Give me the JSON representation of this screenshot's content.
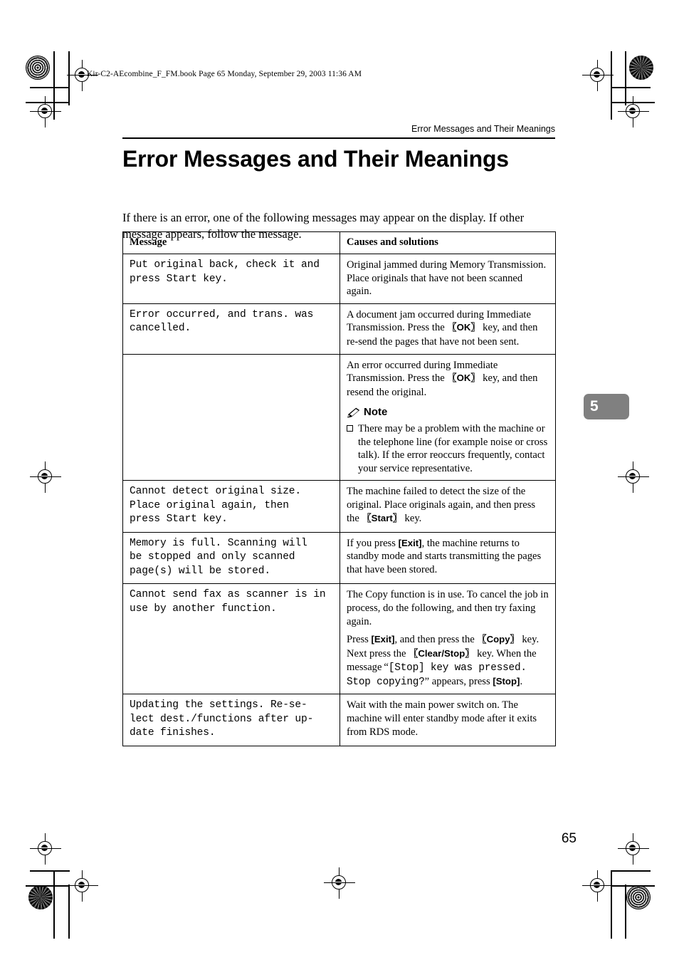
{
  "print_marks": {
    "book_line": "Kir-C2-AEcombine_F_FM.book  Page 65  Monday, September 29, 2003  11:36 AM"
  },
  "header": {
    "running_head": "Error Messages and Their Meanings",
    "title": "Error Messages and Their Meanings"
  },
  "intro": "If there is an error, one of the following messages may appear on the display. If other message appears, follow the message.",
  "table": {
    "columns": [
      "Message",
      "Causes and solutions"
    ],
    "rows": [
      {
        "message": "Put original back, check it and\npress Start key.",
        "solution_paragraphs": [
          "Original jammed during Memory Transmission. Place originals that have not been scanned again."
        ]
      },
      {
        "message": "Error occurred, and trans. was\ncancelled.",
        "solution_paragraphs": [
          "A document jam occurred during Immediate Transmission. Press the 【OK】 key, and then re-send the pages that have not been sent."
        ],
        "second_cell": {
          "paragraph": "An error occurred during Immediate Transmission. Press the 【OK】 key, and then resend the original.",
          "note_label": "Note",
          "note_items": [
            "There may be a problem with the machine or the telephone line (for example noise or cross talk). If the error reoccurs frequently, contact your service representative."
          ]
        }
      },
      {
        "message": "Cannot detect original size.\nPlace original again, then\npress Start key.",
        "solution_paragraphs": [
          "The machine failed to detect the size of the original. Place originals again, and then press the 【Start】 key."
        ]
      },
      {
        "message": "Memory is full. Scanning will\nbe stopped and only scanned\npage(s) will be stored.",
        "solution_paragraphs": [
          "If you press [Exit], the machine returns to standby mode and starts transmitting the pages that have been stored."
        ]
      },
      {
        "message": "Cannot send fax as scanner is in\nuse by another function.",
        "solution_paragraphs": [
          "The Copy function is in use. To cancel the job in process, do the following, and then try faxing again.",
          "Press [Exit], and then press the 【Copy】 key. Next press the 【Clear/Stop】 key. When the message “[Stop] key was pressed. Stop copying?” appears, press [Stop]."
        ]
      },
      {
        "message": "Updating the settings. Re-se-\nlect dest./functions after up-\ndate finishes.",
        "solution_paragraphs": [
          "Wait with the main power switch on. The machine will enter standby mode after it exits from RDS mode."
        ]
      }
    ]
  },
  "keys": {
    "ok": "OK",
    "start": "Start",
    "copy": "Copy",
    "clear_stop": "Clear/Stop",
    "exit": "Exit",
    "stop": "Stop",
    "bracket_open": "【",
    "bracket_close": "】"
  },
  "chapter_tab": "5",
  "folio": "65",
  "colors": {
    "tab_background": "#808080",
    "tab_text": "#ffffff",
    "rule": "#000000"
  }
}
